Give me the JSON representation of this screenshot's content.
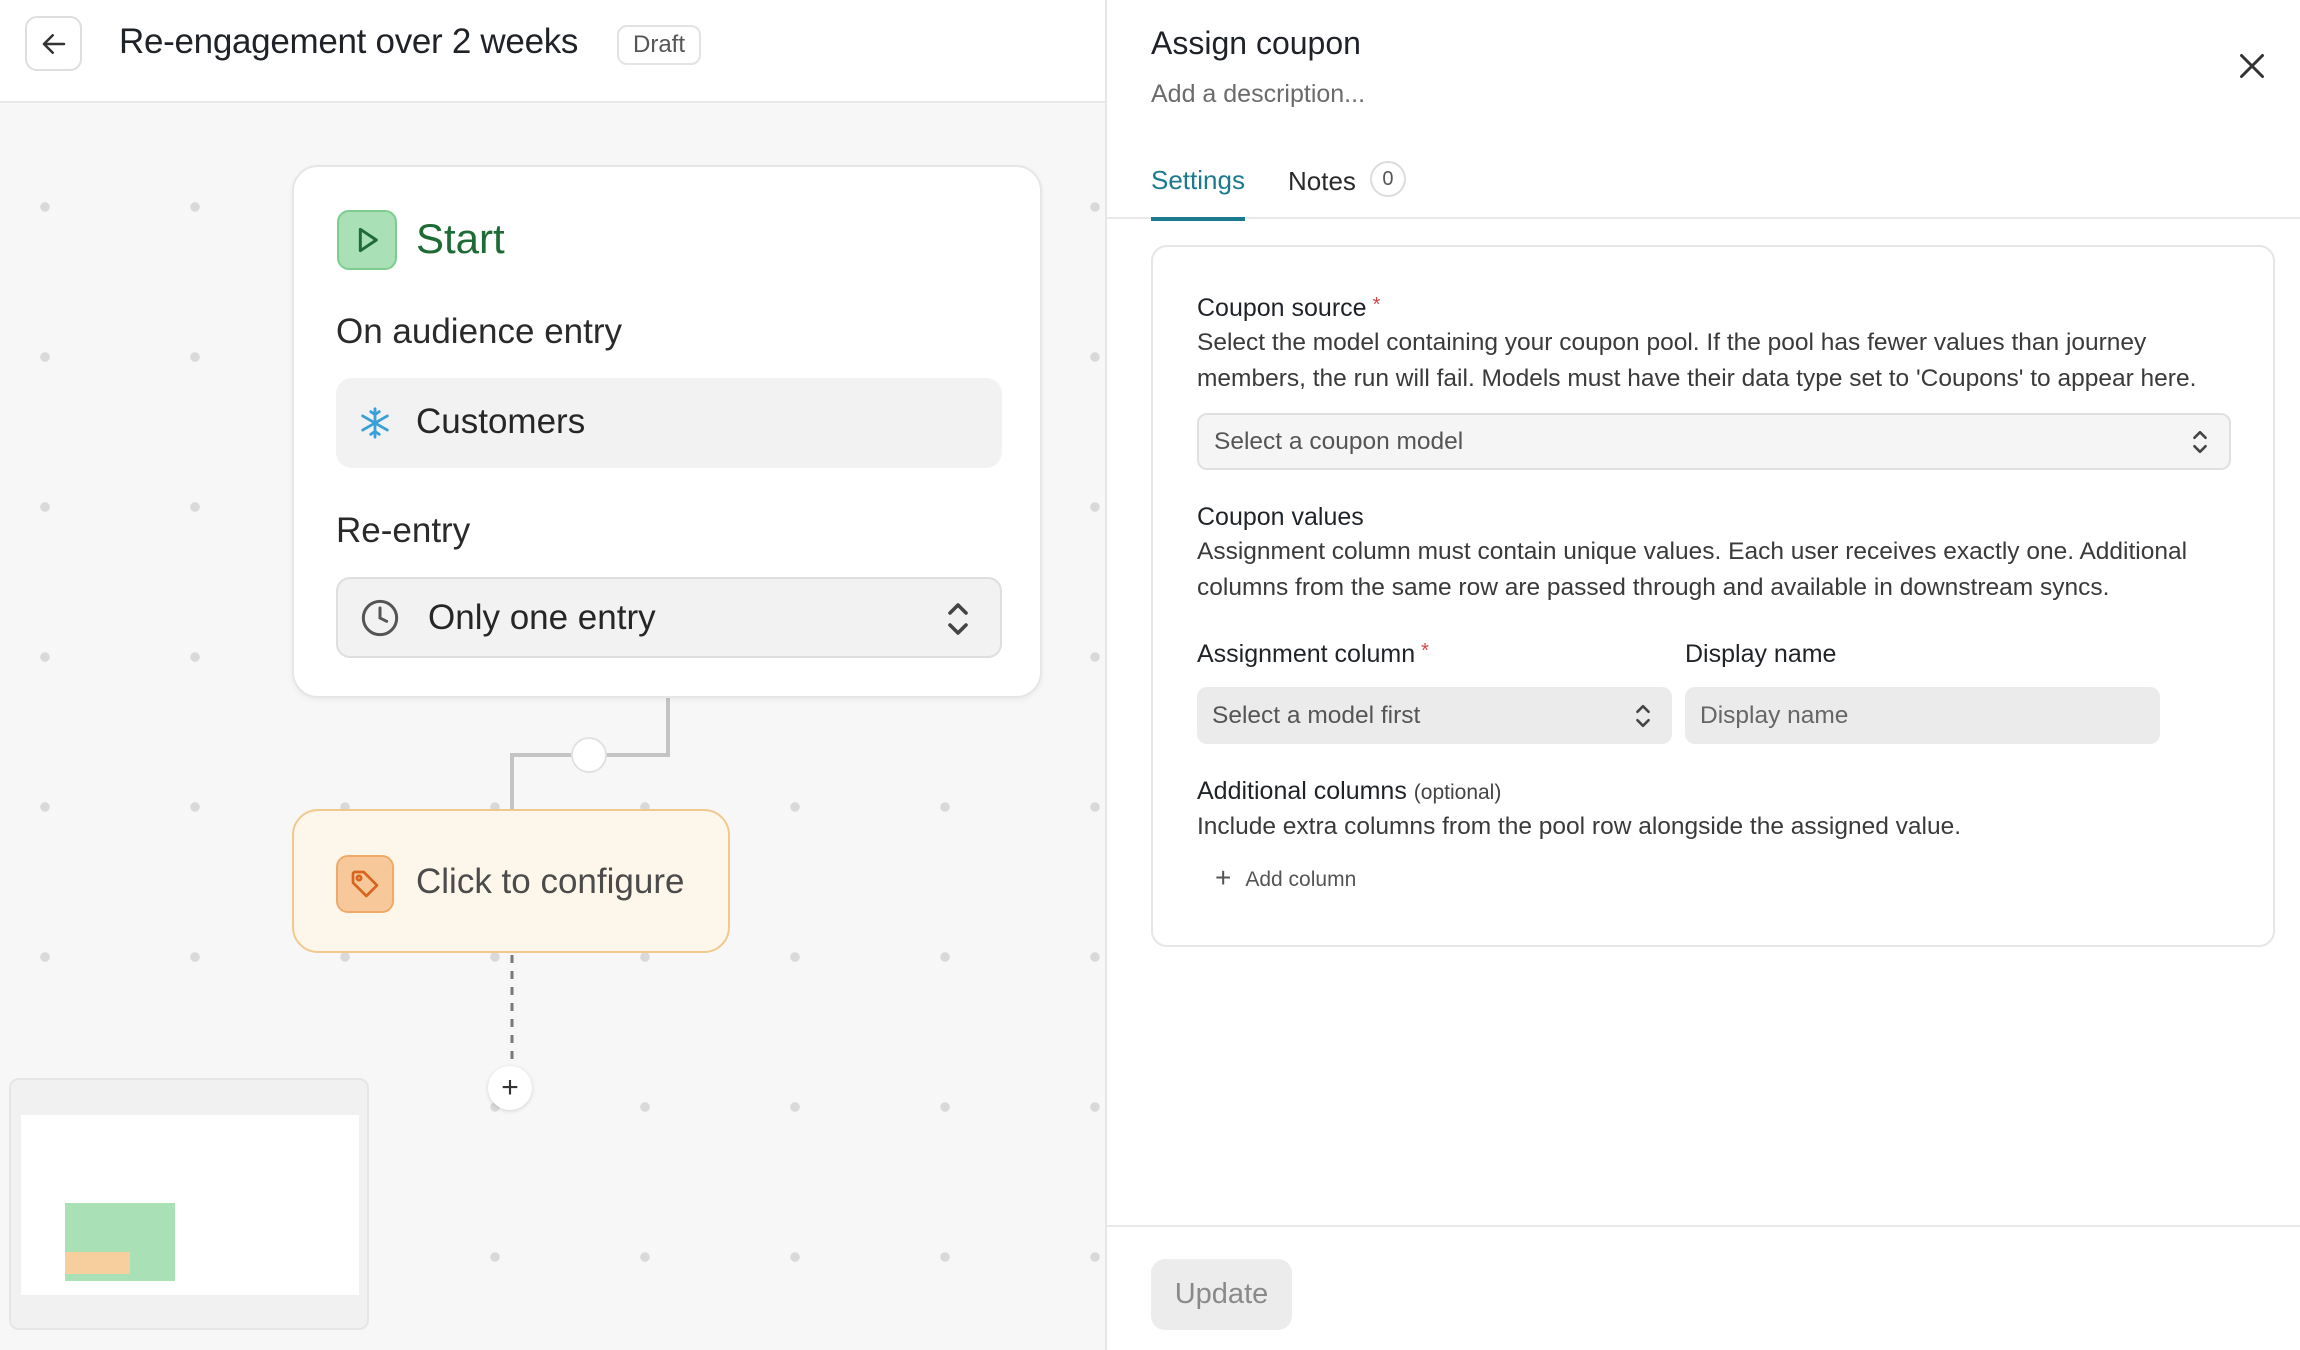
{
  "header": {
    "back_icon": "arrow-left-icon",
    "title": "Re-engagement over 2 weeks",
    "status_badge": "Draft"
  },
  "canvas": {
    "start_node": {
      "icon": "play-icon",
      "label": "Start",
      "audience_label": "On audience entry",
      "audience_icon": "snowflake-icon",
      "audience_name": "Customers",
      "reentry_label": "Re-entry",
      "reentry_icon": "clock-icon",
      "reentry_value": "Only one entry"
    },
    "coupon_node": {
      "icon": "tag-icon",
      "label": "Click to configure"
    },
    "add_step_symbol": "+"
  },
  "panel": {
    "title": "Assign coupon",
    "description_placeholder": "Add a description...",
    "close_icon": "close-icon",
    "tabs": [
      {
        "label": "Settings",
        "active": true
      },
      {
        "label": "Notes",
        "count": "0",
        "active": false
      }
    ],
    "coupon_source": {
      "label": "Coupon source",
      "required_marker": "*",
      "help": "Select the model containing your coupon pool. If the pool has fewer values than journey members, the run will fail. Models must have their data type set to 'Coupons' to appear here.",
      "placeholder": "Select a coupon model"
    },
    "coupon_values": {
      "label": "Coupon values",
      "help": "Assignment column must contain unique values. Each user receives exactly one. Additional columns from the same row are passed through and available in downstream syncs."
    },
    "assignment_column": {
      "label": "Assignment column",
      "required_marker": "*",
      "placeholder": "Select a model first"
    },
    "display_name": {
      "label": "Display name",
      "placeholder": "Display name"
    },
    "additional_columns": {
      "label": "Additional columns",
      "optional_hint": "(optional)",
      "help": "Include extra columns from the pool row alongside the assigned value.",
      "add_label": "Add column",
      "add_symbol": "+"
    },
    "footer": {
      "update_label": "Update"
    }
  },
  "colors": {
    "accent_teal": "#1c7a8f",
    "start_green": "#1e6b35",
    "start_icon_bg": "#a9e0b6",
    "coupon_node_bg": "#fdf6ea",
    "coupon_node_border": "#f1c98e",
    "required_red": "#d64545"
  }
}
